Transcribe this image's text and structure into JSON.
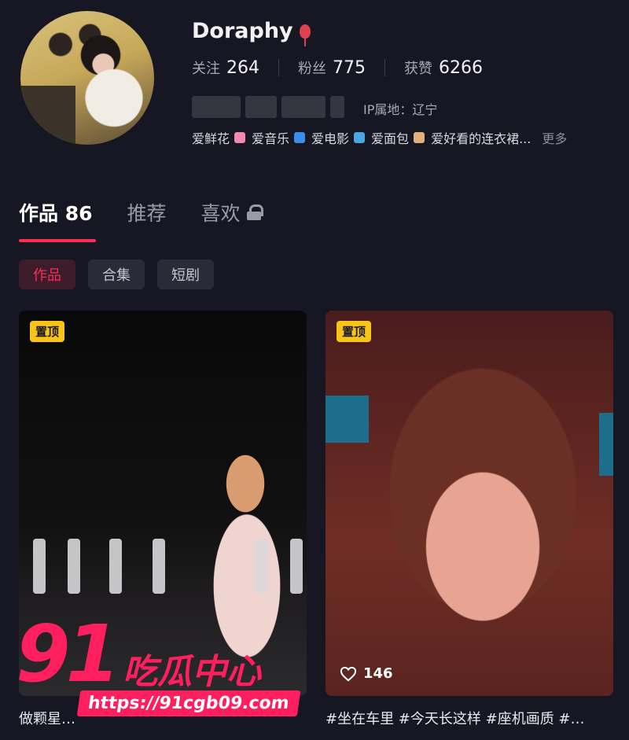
{
  "profile": {
    "username": "Doraphy",
    "stats": [
      {
        "label": "关注",
        "value": "264"
      },
      {
        "label": "粉丝",
        "value": "775"
      },
      {
        "label": "获赞",
        "value": "6266"
      }
    ],
    "ip_location": "IP属地：辽宁",
    "interests": [
      "爱鲜花",
      "爱音乐",
      "爱电影",
      "爱面包",
      "爱好看的连衣裙..."
    ],
    "more": "更多"
  },
  "tabs": [
    {
      "label": "作品 86"
    },
    {
      "label": "推荐"
    },
    {
      "label": "喜欢"
    }
  ],
  "chips": [
    "作品",
    "合集",
    "短剧"
  ],
  "videos": [
    {
      "badge": "置顶",
      "likes": "",
      "caption": "做颗星…"
    },
    {
      "badge": "置顶",
      "likes": "146",
      "caption": "#坐在车里 #今天长这样 #座机画质 #…"
    }
  ],
  "watermark": {
    "number": "91",
    "brand": "吃瓜中心",
    "url": "https://91cgb09.com"
  },
  "colors": {
    "background": "#161722",
    "accent": "#fe2c55",
    "pin_badge": "#f8c419"
  }
}
